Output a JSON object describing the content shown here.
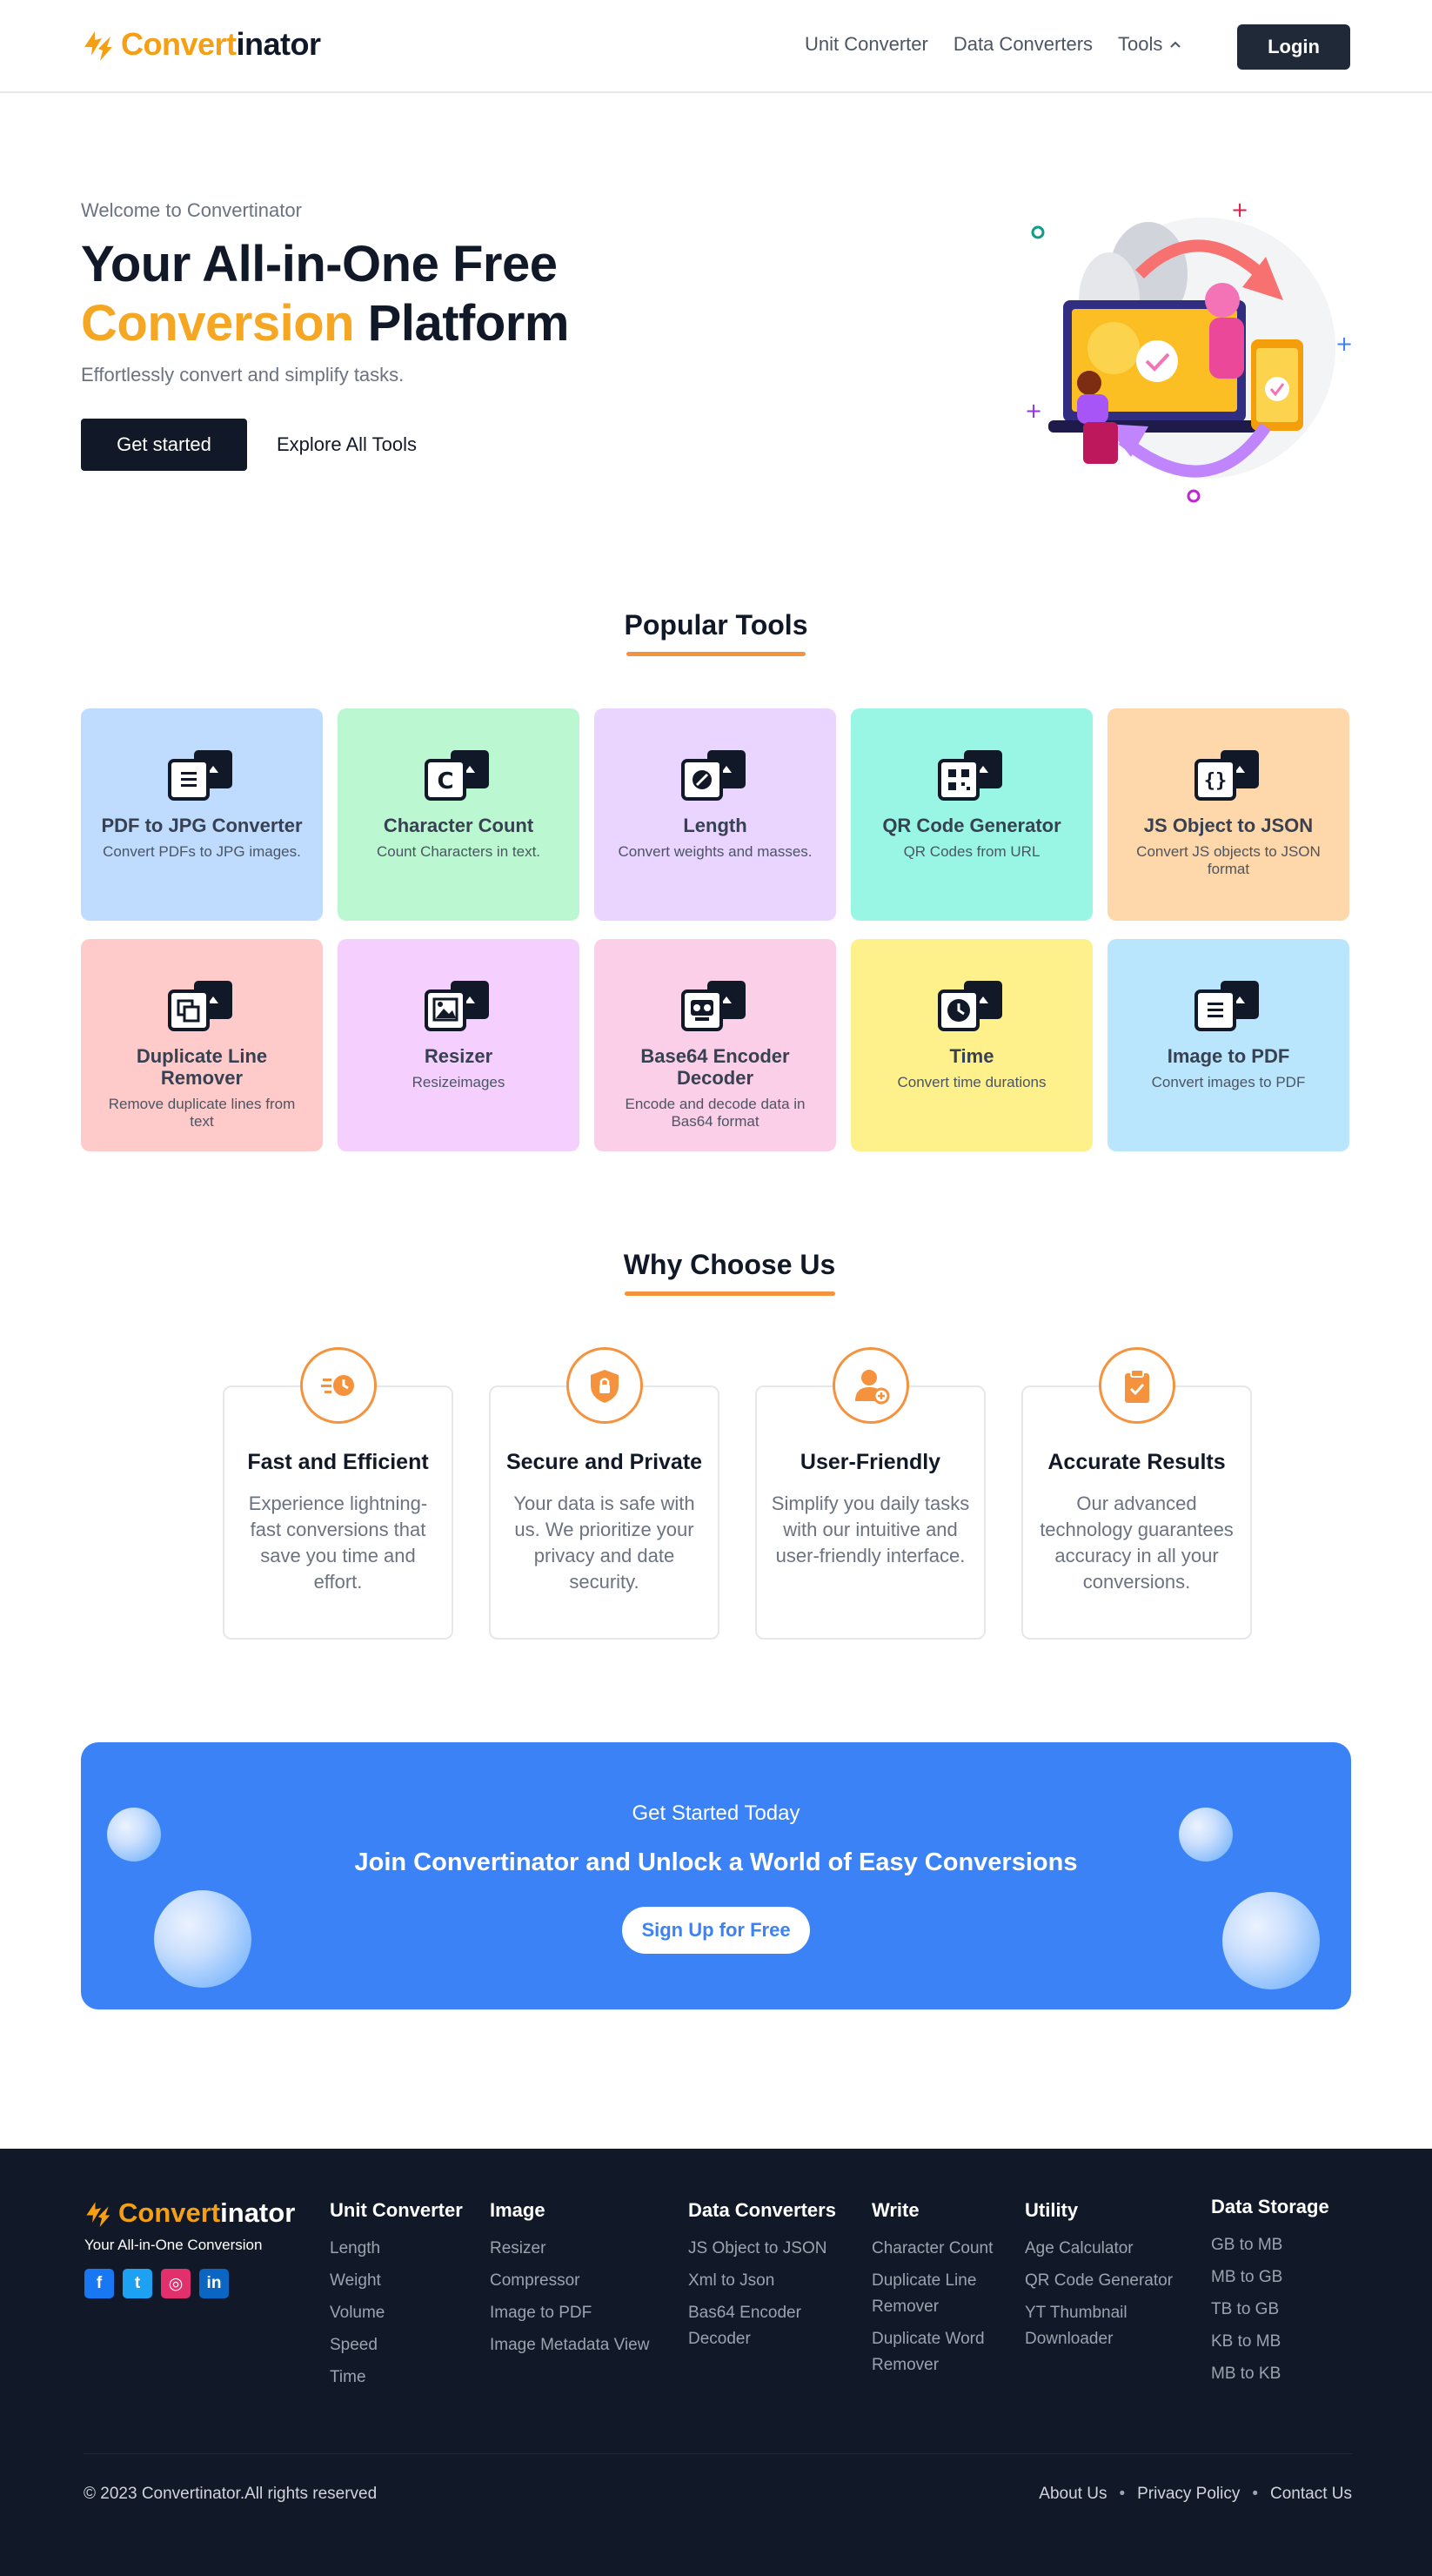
{
  "brand": {
    "part1": "Convert",
    "part2": "inator",
    "accent_color": "#f5a014"
  },
  "nav": {
    "links": [
      "Unit Converter",
      "Data Converters",
      "Tools"
    ],
    "login": "Login"
  },
  "hero": {
    "welcome": "Welcome to Convertinator",
    "title_line1": "Your All-in-One Free",
    "title_accent": "Conversion",
    "title_rest": " Platform",
    "subtitle": "Effortlessly convert and simplify tasks.",
    "primary_button": "Get started",
    "secondary_button": "Explore All Tools"
  },
  "popular": {
    "title": "Popular Tools",
    "tools": [
      {
        "name": "PDF to JPG Converter",
        "desc": "Convert PDFs to JPG images.",
        "bg": "#bfdbfe",
        "icon": "document-icon"
      },
      {
        "name": "Character Count",
        "desc": "Count Characters in text.",
        "bg": "#bbf7d0",
        "icon": "letter-c-icon"
      },
      {
        "name": "Length",
        "desc": "Convert weights and masses.",
        "bg": "#e9d5ff",
        "icon": "ruler-icon"
      },
      {
        "name": "QR Code Generator",
        "desc": "QR Codes from URL",
        "bg": "#99f6e4",
        "icon": "qr-code-icon"
      },
      {
        "name": "JS Object to JSON",
        "desc": "Convert JS objects to JSON format",
        "bg": "#fed7aa",
        "icon": "braces-icon"
      },
      {
        "name": "Duplicate Line Remover",
        "desc": "Remove duplicate lines from text",
        "bg": "#fecaca",
        "icon": "copy-icon"
      },
      {
        "name": "Resizer",
        "desc": "Resizeimages",
        "bg": "#f5d0fe",
        "icon": "image-icon"
      },
      {
        "name": "Base64 Encoder Decoder",
        "desc": "Encode and decode data in Bas64 format",
        "bg": "#fbcfe8",
        "icon": "encoder-icon"
      },
      {
        "name": "Time",
        "desc": "Convert time durations",
        "bg": "#fef08a",
        "icon": "clock-icon"
      },
      {
        "name": "Image to PDF",
        "desc": "Convert images to PDF",
        "bg": "#bae6fd",
        "icon": "document-icon"
      }
    ]
  },
  "why": {
    "title": "Why Choose Us",
    "cards": [
      {
        "title": "Fast and Efficient",
        "desc": "Experience lightning-fast conversions that save you time and effort.",
        "icon": "fast-clock-icon"
      },
      {
        "title": "Secure and Private",
        "desc": "Your data is safe with us. We prioritize your privacy and date security.",
        "icon": "shield-lock-icon"
      },
      {
        "title": "User-Friendly",
        "desc": "Simplify you daily tasks with our intuitive and user-friendly interface.",
        "icon": "user-plus-icon"
      },
      {
        "title": "Accurate Results",
        "desc": "Our advanced technology guarantees accuracy in all your conversions.",
        "icon": "clipboard-check-icon"
      }
    ]
  },
  "cta": {
    "kicker": "Get Started Today",
    "title": "Join Convertinator and Unlock a World of Easy Conversions",
    "button": "Sign Up for Free"
  },
  "footer": {
    "tagline": "Your All-in-One Conversion",
    "socials": [
      {
        "name": "facebook-icon",
        "glyph": "f",
        "color": "#1877f2"
      },
      {
        "name": "twitter-icon",
        "glyph": "t",
        "color": "#1da1f2"
      },
      {
        "name": "instagram-icon",
        "glyph": "◎",
        "color": "#e1306c"
      },
      {
        "name": "linkedin-icon",
        "glyph": "in",
        "color": "#0a66c2"
      }
    ],
    "columns": [
      {
        "heading": "Unit Converter",
        "links": [
          "Length",
          "Weight",
          "Volume",
          "Speed",
          "Time"
        ]
      },
      {
        "heading": "Image",
        "links": [
          "Resizer",
          "Compressor",
          "Image to PDF",
          "Image Metadata View"
        ]
      },
      {
        "heading": "Data Converters",
        "links": [
          "JS Object to JSON",
          "Xml to Json",
          "Bas64 Encoder Decoder"
        ]
      },
      {
        "heading": "Write",
        "links": [
          "Character Count",
          "Duplicate Line Remover",
          "Duplicate Word Remover"
        ]
      },
      {
        "heading": "Utility",
        "links": [
          "Age Calculator",
          "QR Code Generator",
          "YT Thumbnail Downloader"
        ]
      },
      {
        "heading": "Data Storage",
        "links": [
          "GB to MB",
          "MB to GB",
          "TB to GB",
          "KB to MB",
          "MB to KB"
        ]
      }
    ],
    "copyright": "© 2023 Convertinator.All rights reserved",
    "bottom_links": [
      "About Us",
      "Privacy Policy",
      "Contact Us"
    ]
  }
}
